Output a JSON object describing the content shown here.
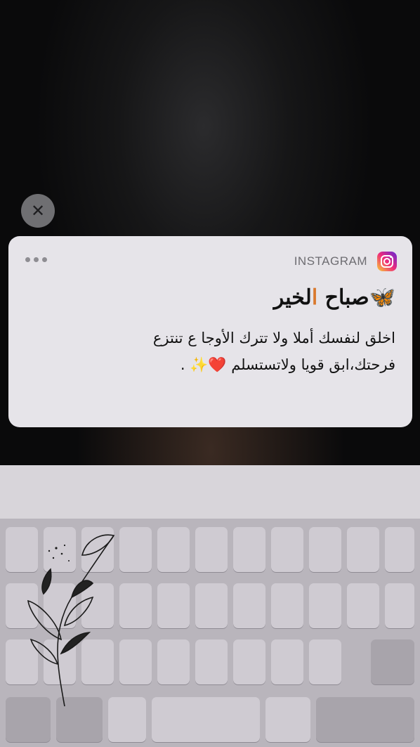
{
  "notification": {
    "app_name": "INSTAGRAM",
    "app_icon": "instagram-icon",
    "title_part1": "صباح ",
    "title_highlight": "ا",
    "title_part2": "لخير",
    "title_emoji": "🦋",
    "body_line1": "اخلق لنفسك أملا ولا تترك الأوجا ع تنتزع",
    "body_line2": "فرحتك،ابق قويا ولاتستسلم ❤️✨ ."
  },
  "close_icon": "✕",
  "colors": {
    "notification_bg": "#e6e4e9",
    "accent": "#d9782c",
    "keyboard_bg": "#b9b5bc"
  }
}
